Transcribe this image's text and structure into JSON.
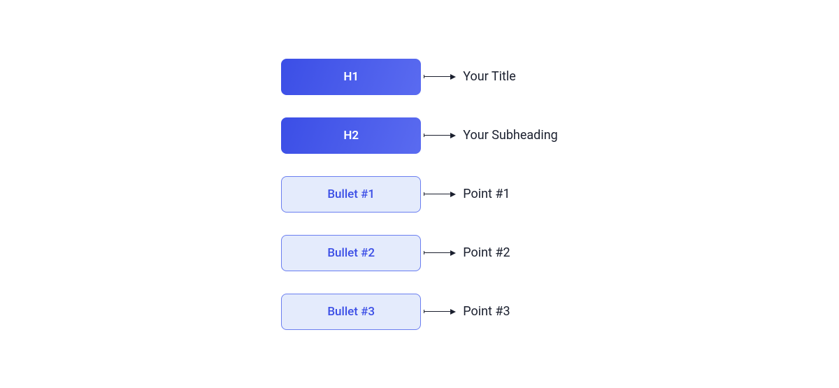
{
  "rows": [
    {
      "box": "H1",
      "style": "filled",
      "label": "Your Title"
    },
    {
      "box": "H2",
      "style": "filled",
      "label": "Your Subheading"
    },
    {
      "box": "Bullet #1",
      "style": "outline",
      "label": "Point #1"
    },
    {
      "box": "Bullet #2",
      "style": "outline",
      "label": "Point #2"
    },
    {
      "box": "Bullet #3",
      "style": "outline",
      "label": "Point #3"
    }
  ]
}
